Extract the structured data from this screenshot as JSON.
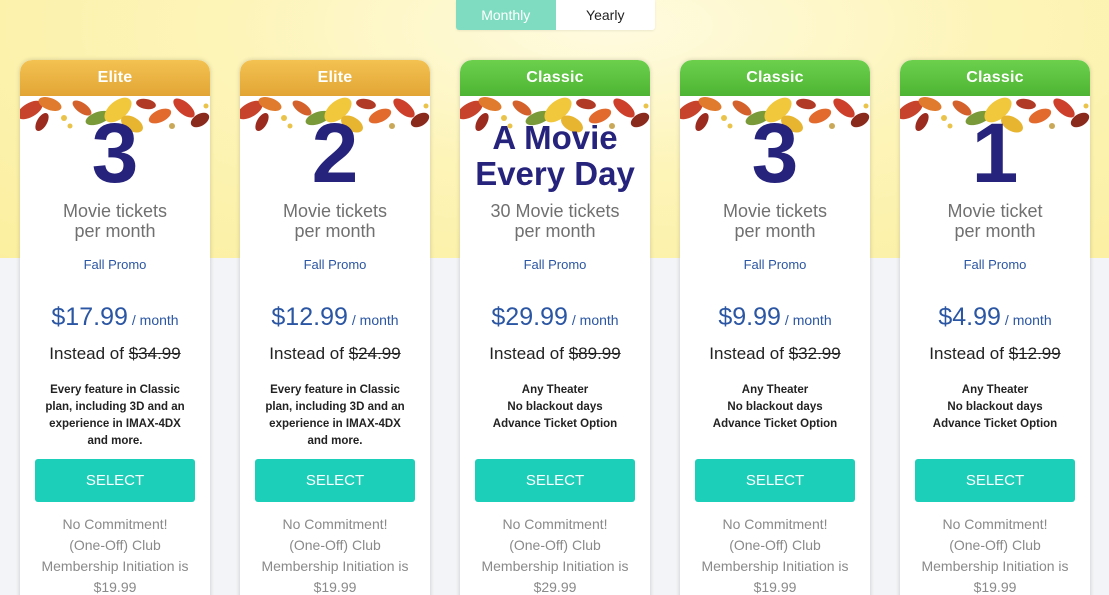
{
  "billing_toggle": {
    "monthly_label": "Monthly",
    "yearly_label": "Yearly",
    "selected": "Monthly"
  },
  "colors": {
    "elite_header": "#e9b03f",
    "classic_header": "#58c03b",
    "headline": "#26237c",
    "price": "#2b56a3",
    "select_button": "#1ccfb9",
    "toggle_active": "#7fdcc0"
  },
  "plans": [
    {
      "tier": "Elite",
      "headline": "3",
      "subtitle_line1": "Movie tickets",
      "subtitle_line2": "per month",
      "promo": "Fall Promo",
      "price": "$17.99",
      "period": "/ month",
      "instead_label": "Instead of",
      "original_price": "$34.99",
      "features": [
        "Every feature in Classic",
        "plan, including 3D and an",
        "experience in IMAX-4DX",
        "and more."
      ],
      "select_label": "SELECT",
      "note": [
        "No Commitment!",
        "(One-Off) Club",
        "Membership Initiation is",
        "$19.99"
      ]
    },
    {
      "tier": "Elite",
      "headline": "2",
      "subtitle_line1": "Movie tickets",
      "subtitle_line2": "per month",
      "promo": "Fall Promo",
      "price": "$12.99",
      "period": "/ month",
      "instead_label": "Instead of",
      "original_price": "$24.99",
      "features": [
        "Every feature in Classic",
        "plan, including 3D and an",
        "experience in IMAX-4DX",
        "and more."
      ],
      "select_label": "SELECT",
      "note": [
        "No Commitment!",
        "(One-Off) Club",
        "Membership Initiation is",
        "$19.99"
      ]
    },
    {
      "tier": "Classic",
      "headline_line1": "A Movie",
      "headline_line2": "Every Day",
      "subtitle_line1": "30 Movie tickets",
      "subtitle_line2": "per month",
      "promo": "Fall Promo",
      "price": "$29.99",
      "period": "/ month",
      "instead_label": "Instead of",
      "original_price": "$89.99",
      "features": [
        "Any Theater",
        "No blackout days",
        "Advance Ticket Option"
      ],
      "select_label": "SELECT",
      "note": [
        "No Commitment!",
        "(One-Off) Club",
        "Membership Initiation is",
        "$29.99"
      ]
    },
    {
      "tier": "Classic",
      "headline": "3",
      "subtitle_line1": "Movie tickets",
      "subtitle_line2": "per month",
      "promo": "Fall Promo",
      "price": "$9.99",
      "period": "/ month",
      "instead_label": "Instead of",
      "original_price": "$32.99",
      "features": [
        "Any Theater",
        "No blackout days",
        "Advance Ticket Option"
      ],
      "select_label": "SELECT",
      "note": [
        "No Commitment!",
        "(One-Off) Club",
        "Membership Initiation is",
        "$19.99"
      ]
    },
    {
      "tier": "Classic",
      "headline": "1",
      "subtitle_line1": "Movie ticket",
      "subtitle_line2": "per month",
      "promo": "Fall Promo",
      "price": "$4.99",
      "period": "/ month",
      "instead_label": "Instead of",
      "original_price": "$12.99",
      "features": [
        "Any Theater",
        "No blackout days",
        "Advance Ticket Option"
      ],
      "select_label": "SELECT",
      "note": [
        "No Commitment!",
        "(One-Off) Club",
        "Membership Initiation is",
        "$19.99"
      ]
    }
  ]
}
